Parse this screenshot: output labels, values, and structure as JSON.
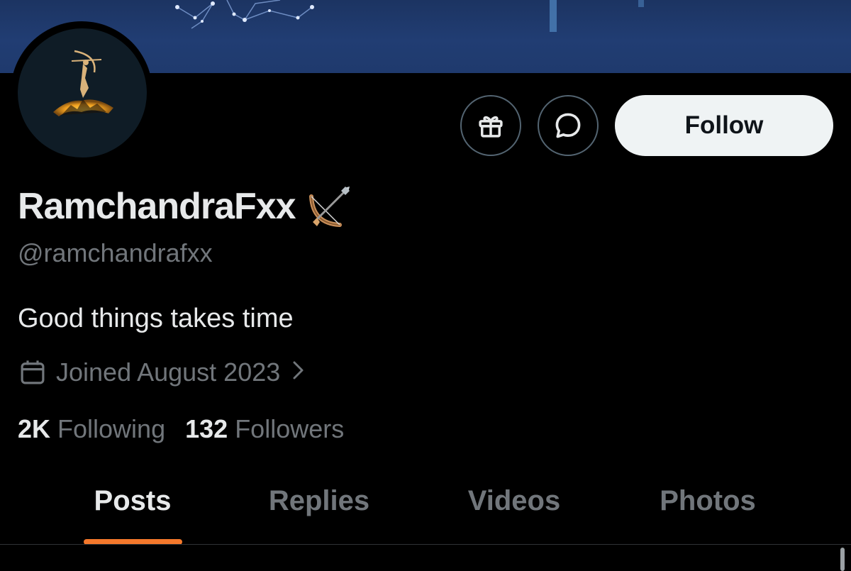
{
  "profile": {
    "display_name": "RamchandraFxx",
    "handle": "@ramchandrafxx",
    "bio": "Good things takes time",
    "joined": "Joined August 2023",
    "following_count": "2K",
    "following_label": "Following",
    "followers_count": "132",
    "followers_label": "Followers"
  },
  "actions": {
    "follow_label": "Follow",
    "gift_icon": "gift-icon",
    "message_icon": "message-bubble-icon"
  },
  "tabs": [
    {
      "label": "Posts",
      "active": true
    },
    {
      "label": "Replies",
      "active": false
    },
    {
      "label": "Videos",
      "active": false
    },
    {
      "label": "Photos",
      "active": false
    }
  ],
  "icons": {
    "calendar": "calendar-icon",
    "chevron": "chevron-right-icon",
    "name_emoji": "bow-and-arrow-icon"
  },
  "colors": {
    "background": "#000000",
    "banner": "#213d73",
    "primary_text": "#e7e9ea",
    "secondary_text": "#71767b",
    "follow_button_bg": "#eff3f4",
    "tab_indicator": "#f4782b"
  }
}
